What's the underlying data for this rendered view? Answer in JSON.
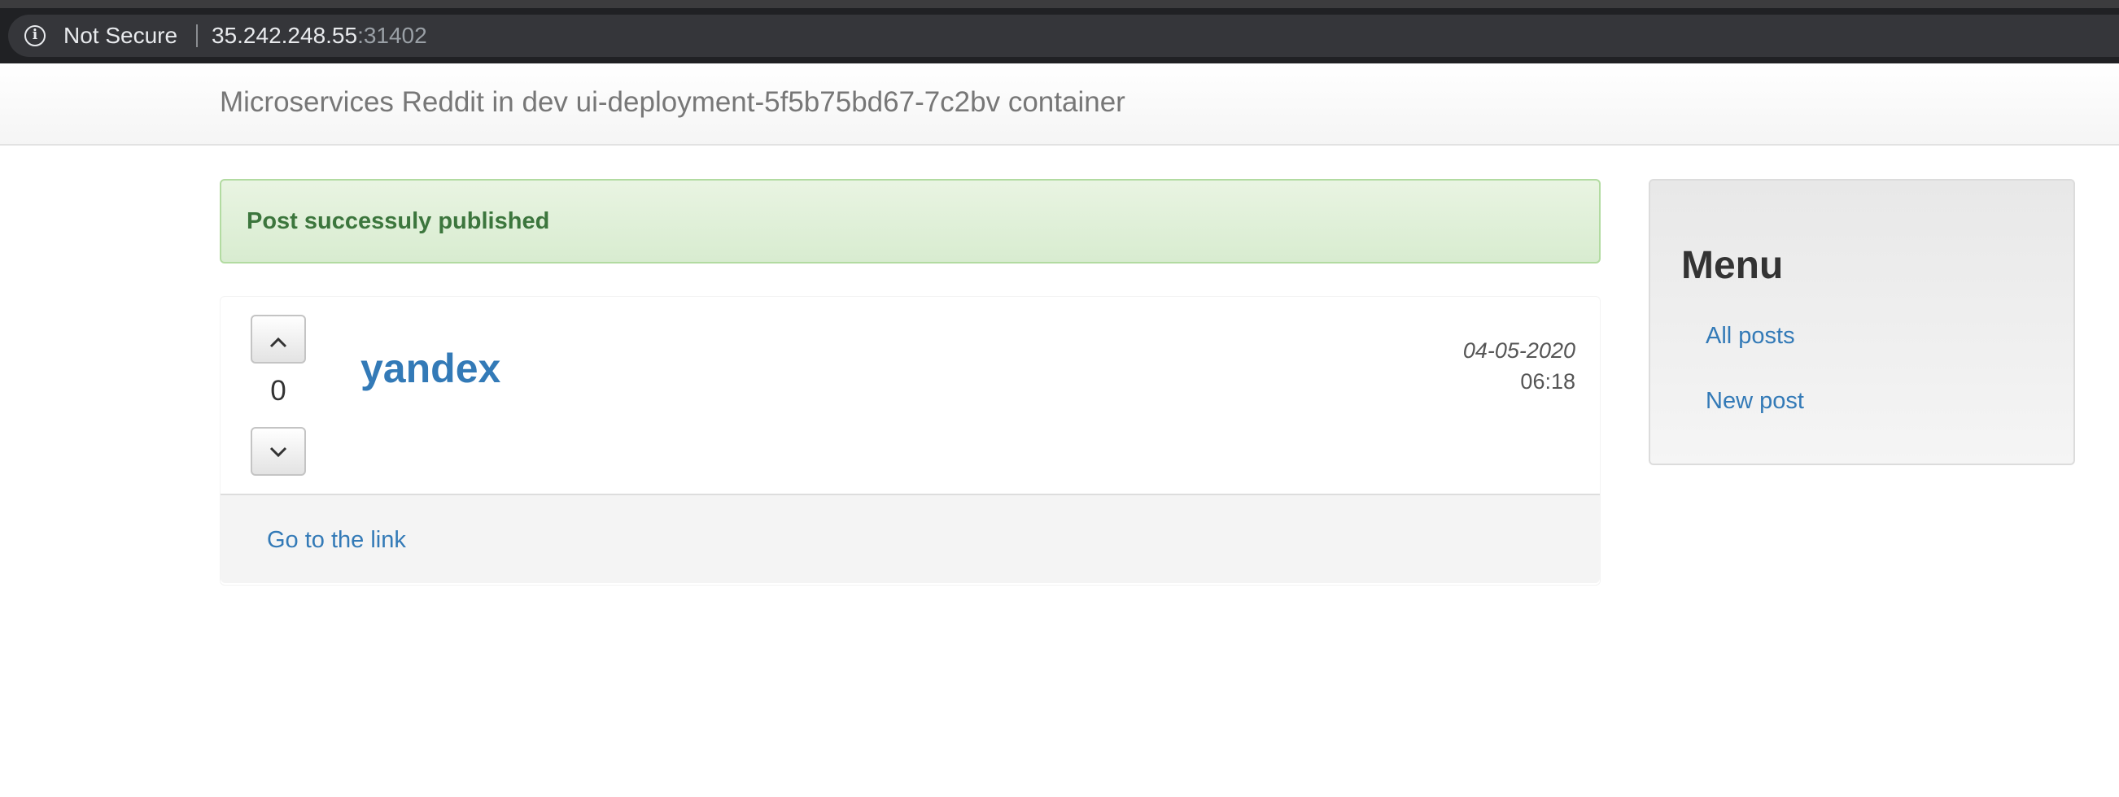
{
  "browser": {
    "security_label": "Not Secure",
    "info_icon": "info-icon",
    "url_host": "35.242.248.55",
    "url_port": ":31402"
  },
  "navbar": {
    "brand": "Microservices Reddit in dev ui-deployment-5f5b75bd67-7c2bv container"
  },
  "alert": {
    "message": "Post successuly published",
    "color": "#3c763d",
    "background": "#dff0d8"
  },
  "post": {
    "upvote_icon": "chevron-up-icon",
    "downvote_icon": "chevron-down-icon",
    "votes": "0",
    "title": "yandex",
    "date": "04-05-2020",
    "time": "06:18",
    "link_label": "Go to the link"
  },
  "sidebar": {
    "heading": "Menu",
    "items": [
      {
        "label": "All posts"
      },
      {
        "label": "New post"
      }
    ]
  },
  "colors": {
    "link": "#337ab7",
    "browser_chrome": "#202124"
  }
}
